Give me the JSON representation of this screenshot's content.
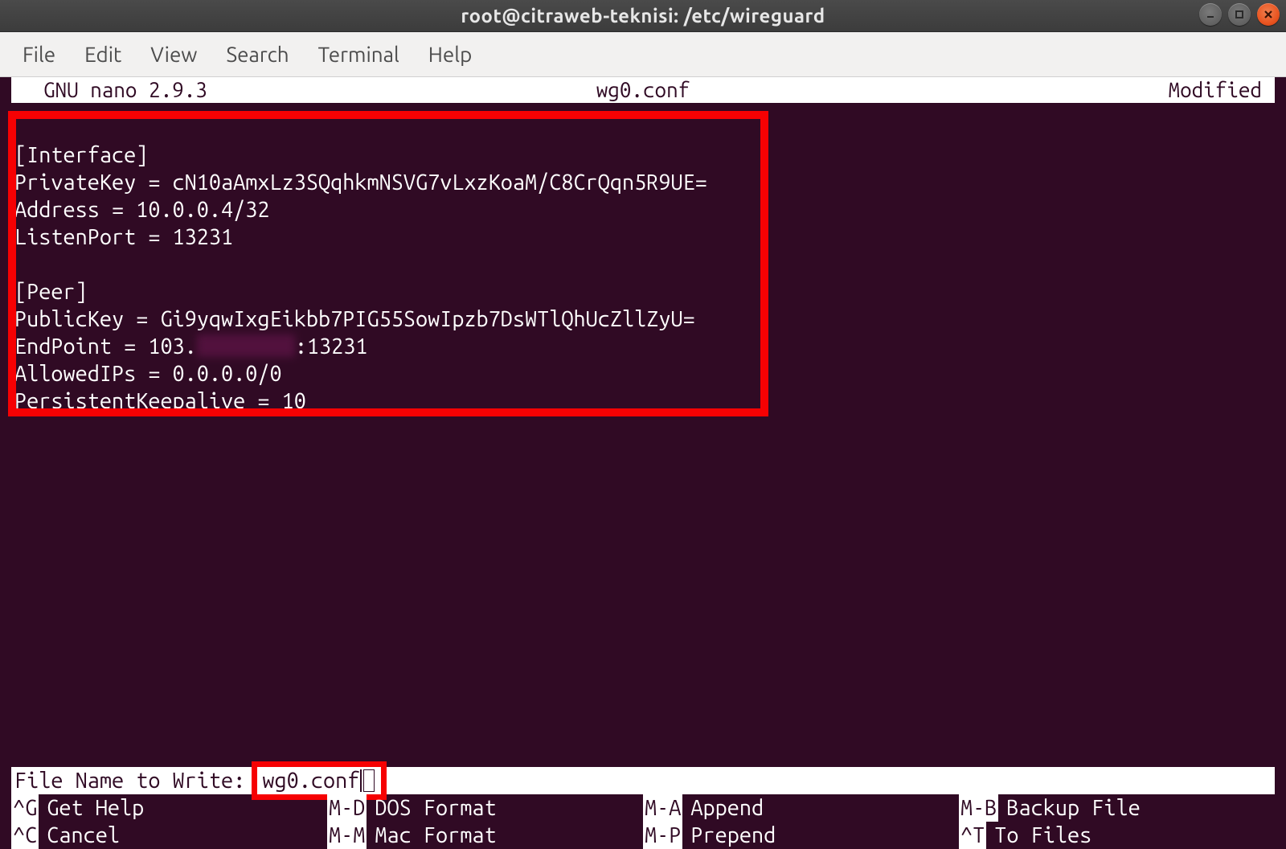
{
  "window": {
    "title": "root@citraweb-teknisi: /etc/wireguard"
  },
  "menubar": {
    "items": [
      "File",
      "Edit",
      "View",
      "Search",
      "Terminal",
      "Help"
    ]
  },
  "nano": {
    "version": "GNU nano 2.9.3",
    "filename": "wg0.conf",
    "status": "Modified",
    "prompt_label": "File Name to Write: ",
    "prompt_value": "wg0.conf"
  },
  "config": {
    "interface_header": "[Interface]",
    "private_key": "PrivateKey = cN10aAmxLz3SQqhkmNSVG7vLxzKoaM/C8CrQqn5R9UE=",
    "address": "Address = 10.0.0.4/32",
    "listen_port": "ListenPort = 13231",
    "peer_header": "[Peer]",
    "public_key": "PublicKey = Gi9yqwIxgEikbb7PIG55SowIpzb7DsWTlQhUcZllZyU=",
    "endpoint_pre": "EndPoint = 103.",
    "endpoint_post": ":13231",
    "allowed_ips": "AllowedIPs = 0.0.0.0/0",
    "keepalive": "PersistentKeepalive = 10"
  },
  "shortcuts": {
    "row1": [
      {
        "key": "^G",
        "label": "Get Help"
      },
      {
        "key": "M-D",
        "label": "DOS Format"
      },
      {
        "key": "M-A",
        "label": "Append"
      },
      {
        "key": "M-B",
        "label": "Backup File"
      }
    ],
    "row2": [
      {
        "key": "^C",
        "label": "Cancel"
      },
      {
        "key": "M-M",
        "label": "Mac Format"
      },
      {
        "key": "M-P",
        "label": "Prepend"
      },
      {
        "key": "^T",
        "label": "To Files"
      }
    ]
  }
}
